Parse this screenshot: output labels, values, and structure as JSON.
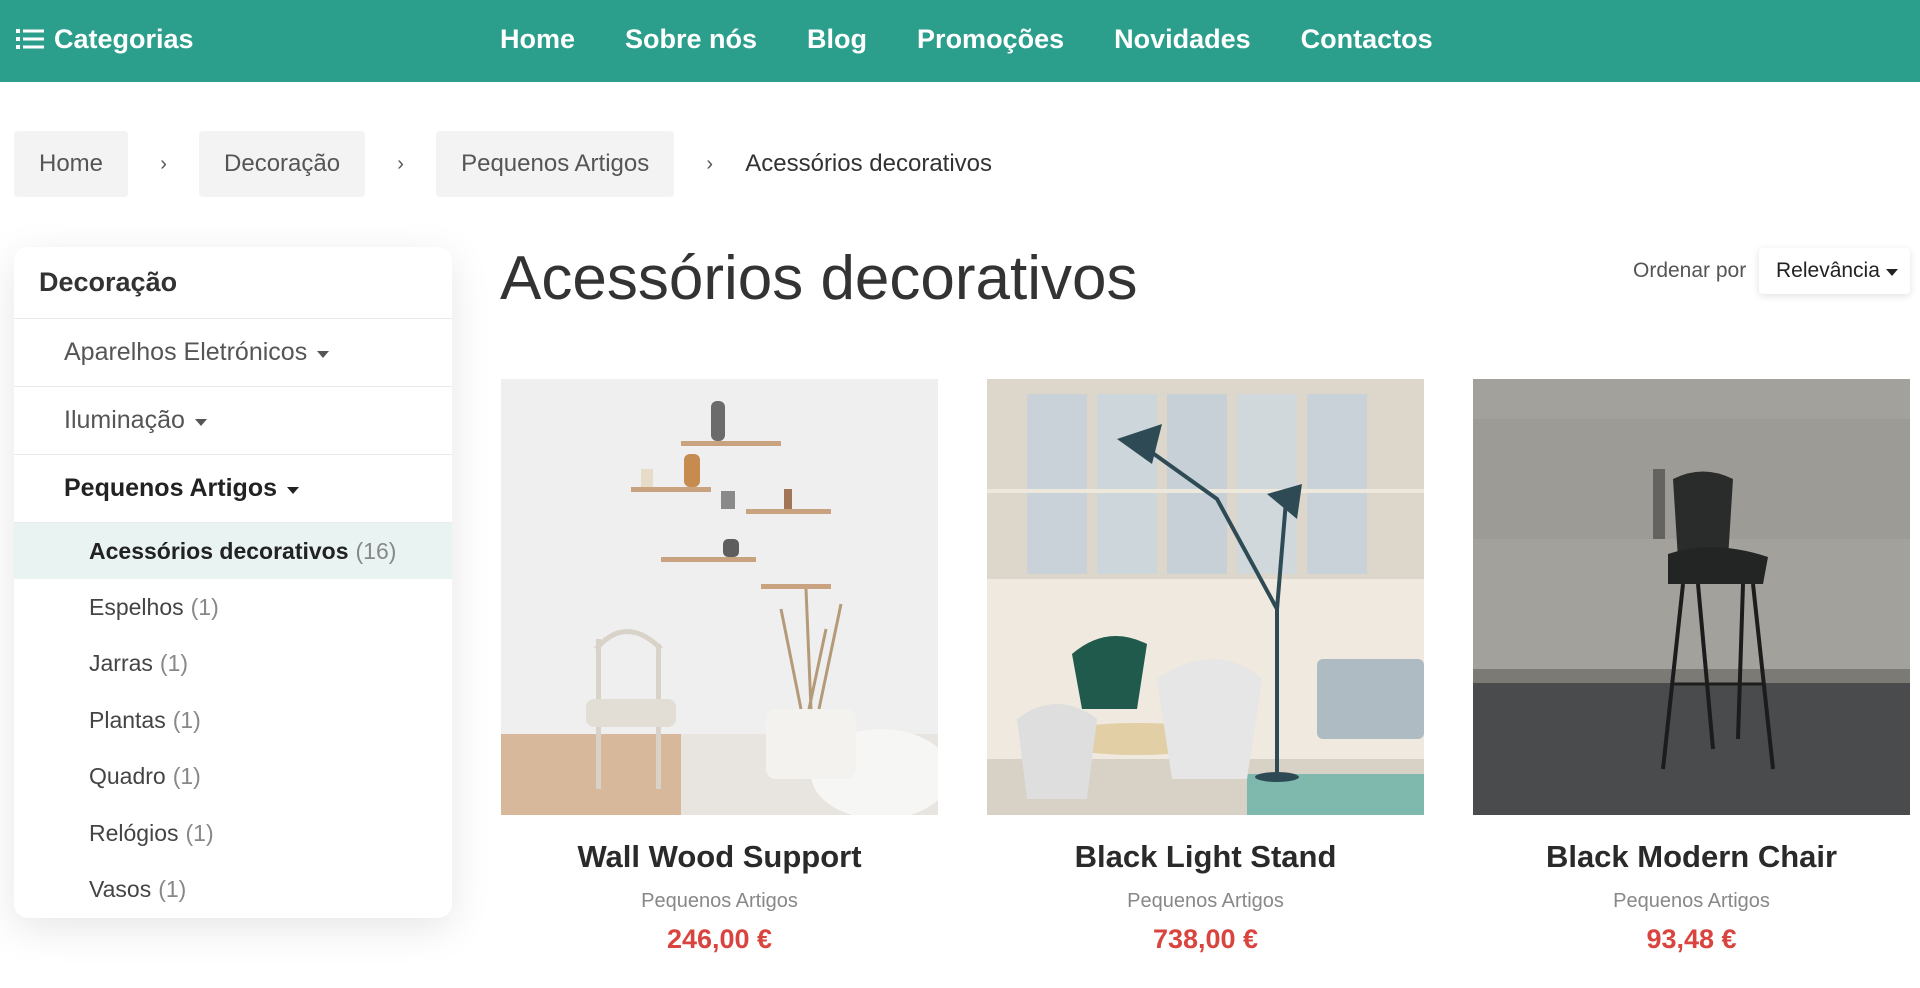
{
  "topbar": {
    "categories_label": "Categorias",
    "nav": [
      "Home",
      "Sobre nós",
      "Blog",
      "Promoções",
      "Novidades",
      "Contactos"
    ],
    "background_color": "#2b9f8c"
  },
  "breadcrumb": {
    "items": [
      "Home",
      "Decoração",
      "Pequenos Artigos"
    ],
    "separator": "›",
    "current": "Acessórios decorativos"
  },
  "sidebar": {
    "title": "Decoração",
    "groups": [
      {
        "label": "Aparelhos Eletrónicos"
      },
      {
        "label": "Iluminação"
      },
      {
        "label": "Pequenos Artigos"
      }
    ],
    "subitems": [
      {
        "label": "Acessórios decorativos",
        "count": "(16)"
      },
      {
        "label": "Espelhos",
        "count": "(1)"
      },
      {
        "label": "Jarras",
        "count": "(1)"
      },
      {
        "label": "Plantas",
        "count": "(1)"
      },
      {
        "label": "Quadro",
        "count": "(1)"
      },
      {
        "label": "Relógios",
        "count": "(1)"
      },
      {
        "label": "Vasos",
        "count": "(1)"
      }
    ]
  },
  "main": {
    "title": "Acessórios decorativos",
    "sort_label": "Ordenar por",
    "sort_value": "Relevância",
    "products": [
      {
        "name": "Wall Wood Support",
        "category": "Pequenos Artigos",
        "price": "246,00 €"
      },
      {
        "name": "Black Light Stand",
        "category": "Pequenos Artigos",
        "price": "738,00 €"
      },
      {
        "name": "Black Modern Chair",
        "category": "Pequenos Artigos",
        "price": "93,48 €"
      }
    ],
    "price_color": "#d9443f"
  }
}
